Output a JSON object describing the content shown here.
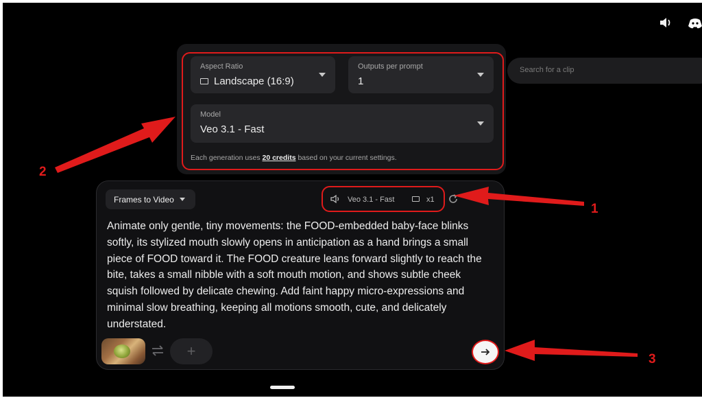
{
  "search": {
    "placeholder": "Search for a clip"
  },
  "settings": {
    "aspect_ratio": {
      "label": "Aspect Ratio",
      "value": "Landscape (16:9)"
    },
    "outputs": {
      "label": "Outputs per prompt",
      "value": "1"
    },
    "model": {
      "label": "Model",
      "value": "Veo 3.1 - Fast"
    },
    "credits_prefix": "Each generation uses ",
    "credits_link": "20 credits",
    "credits_suffix": " based on your current settings."
  },
  "composer": {
    "mode_label": "Frames to Video",
    "model_chip": "Veo 3.1 - Fast",
    "count_chip": "x1",
    "prompt": "Animate only gentle, tiny movements: the FOOD-embedded baby-face blinks softly, its stylized mouth slowly opens in anticipation as a hand brings a small piece of FOOD toward it. The FOOD creature leans forward slightly to reach the bite, takes a small nibble with a soft mouth motion, and shows subtle cheek squish followed by delicate chewing. Add faint happy micro-expressions and minimal slow breathing, keeping all motions smooth, cute, and delicately understated.",
    "add_label": "+"
  },
  "annotations": {
    "marker_1": "1",
    "marker_2": "2",
    "marker_3": "3"
  },
  "icons": [
    "volume-icon",
    "discord-icon",
    "chevron-down-icon",
    "aspect-ratio-icon",
    "swap-icon",
    "arrow-right-icon",
    "refresh-icon"
  ],
  "colors": {
    "background": "#000000",
    "panel": "#171719",
    "highlight": "#e01b1b",
    "send_button": "#f5f5f5"
  }
}
